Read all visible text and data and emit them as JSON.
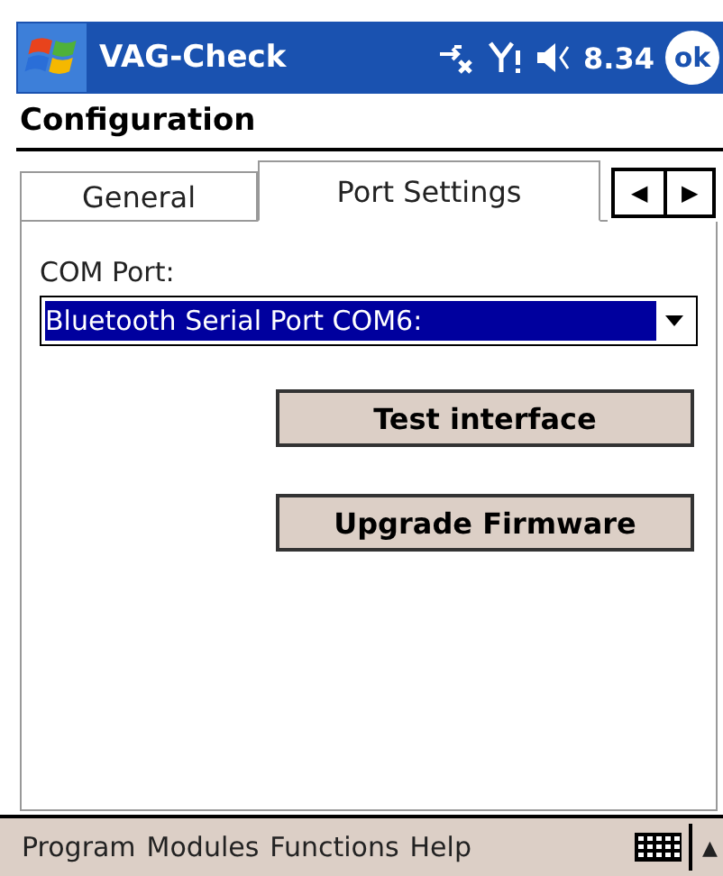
{
  "title_bar": {
    "app_name": "VAG-Check",
    "time": "8.34",
    "ok_label": "ok"
  },
  "header": {
    "title": "Configuration"
  },
  "tabs": [
    {
      "label": "General",
      "selected": false
    },
    {
      "label": "Port Settings",
      "selected": true
    }
  ],
  "tab_scroll": {
    "left": "◀",
    "right": "▶"
  },
  "com_port": {
    "label": "COM Port:",
    "value": "Bluetooth Serial Port COM6:",
    "focused": true
  },
  "buttons": [
    "Test interface",
    "Upgrade Firmware"
  ],
  "menu_bar": {
    "items": [
      "Program",
      "Modules",
      "Functions",
      "Help"
    ],
    "arrow": "▲"
  }
}
